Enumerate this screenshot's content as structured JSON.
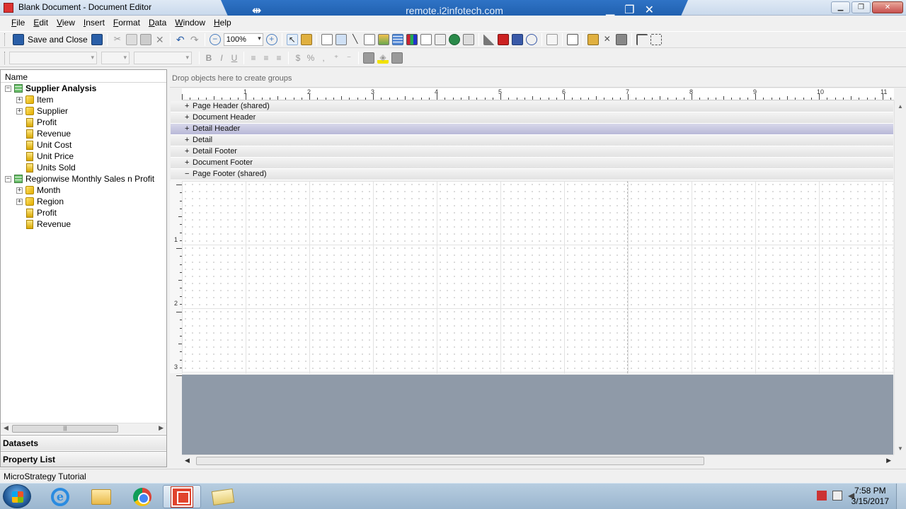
{
  "window": {
    "title": "Blank Document - Document Editor",
    "remote_host": "remote.i2infotech.com"
  },
  "menu": [
    {
      "key": "F",
      "rest": "ile"
    },
    {
      "key": "E",
      "rest": "dit"
    },
    {
      "key": "V",
      "rest": "iew"
    },
    {
      "key": "I",
      "rest": "nsert"
    },
    {
      "key": "F",
      "rest": "ormat"
    },
    {
      "key": "D",
      "rest": "ata"
    },
    {
      "key": "W",
      "rest": "indow"
    },
    {
      "key": "H",
      "rest": "elp"
    }
  ],
  "toolbar": {
    "save_close_label": "Save and Close",
    "zoom": "100%",
    "bold": "B",
    "italic": "I",
    "underline": "U",
    "currency": "$",
    "percent": "%",
    "comma": ","
  },
  "left_panel": {
    "header": "Name",
    "datasets": [
      {
        "name": "Supplier Analysis",
        "items": [
          {
            "type": "attribute",
            "label": "Item"
          },
          {
            "type": "attribute",
            "label": "Supplier"
          },
          {
            "type": "metric",
            "label": "Profit"
          },
          {
            "type": "metric",
            "label": "Revenue"
          },
          {
            "type": "metric",
            "label": "Unit Cost"
          },
          {
            "type": "metric",
            "label": "Unit Price"
          },
          {
            "type": "metric",
            "label": "Units Sold"
          }
        ]
      },
      {
        "name": "Regionwise Monthly Sales n Profit",
        "items": [
          {
            "type": "attribute",
            "label": "Month"
          },
          {
            "type": "attribute",
            "label": "Region"
          },
          {
            "type": "metric",
            "label": "Profit"
          },
          {
            "type": "metric",
            "label": "Revenue"
          }
        ]
      }
    ],
    "sections": {
      "datasets": "Datasets",
      "property_list": "Property List"
    }
  },
  "document": {
    "group_drop_hint": "Drop objects here to create groups",
    "ruler_h_numbers": [
      "1",
      "2",
      "3",
      "4",
      "5",
      "6",
      "7",
      "8",
      "9",
      "10",
      "11"
    ],
    "ruler_v_numbers": [
      "1",
      "2",
      "3"
    ],
    "sections": [
      {
        "sign": "+",
        "label": "Page Header (shared)",
        "selected": false
      },
      {
        "sign": "+",
        "label": "Document Header",
        "selected": false
      },
      {
        "sign": "+",
        "label": "Detail Header",
        "selected": true
      },
      {
        "sign": "+",
        "label": "Detail",
        "selected": false
      },
      {
        "sign": "+",
        "label": "Detail Footer",
        "selected": false
      },
      {
        "sign": "+",
        "label": "Document Footer",
        "selected": false
      },
      {
        "sign": "−",
        "label": "Page Footer (shared)",
        "selected": false
      }
    ]
  },
  "status": {
    "project": "MicroStrategy Tutorial"
  },
  "taskbar": {
    "time": "7:58 PM",
    "date": "3/15/2017"
  }
}
